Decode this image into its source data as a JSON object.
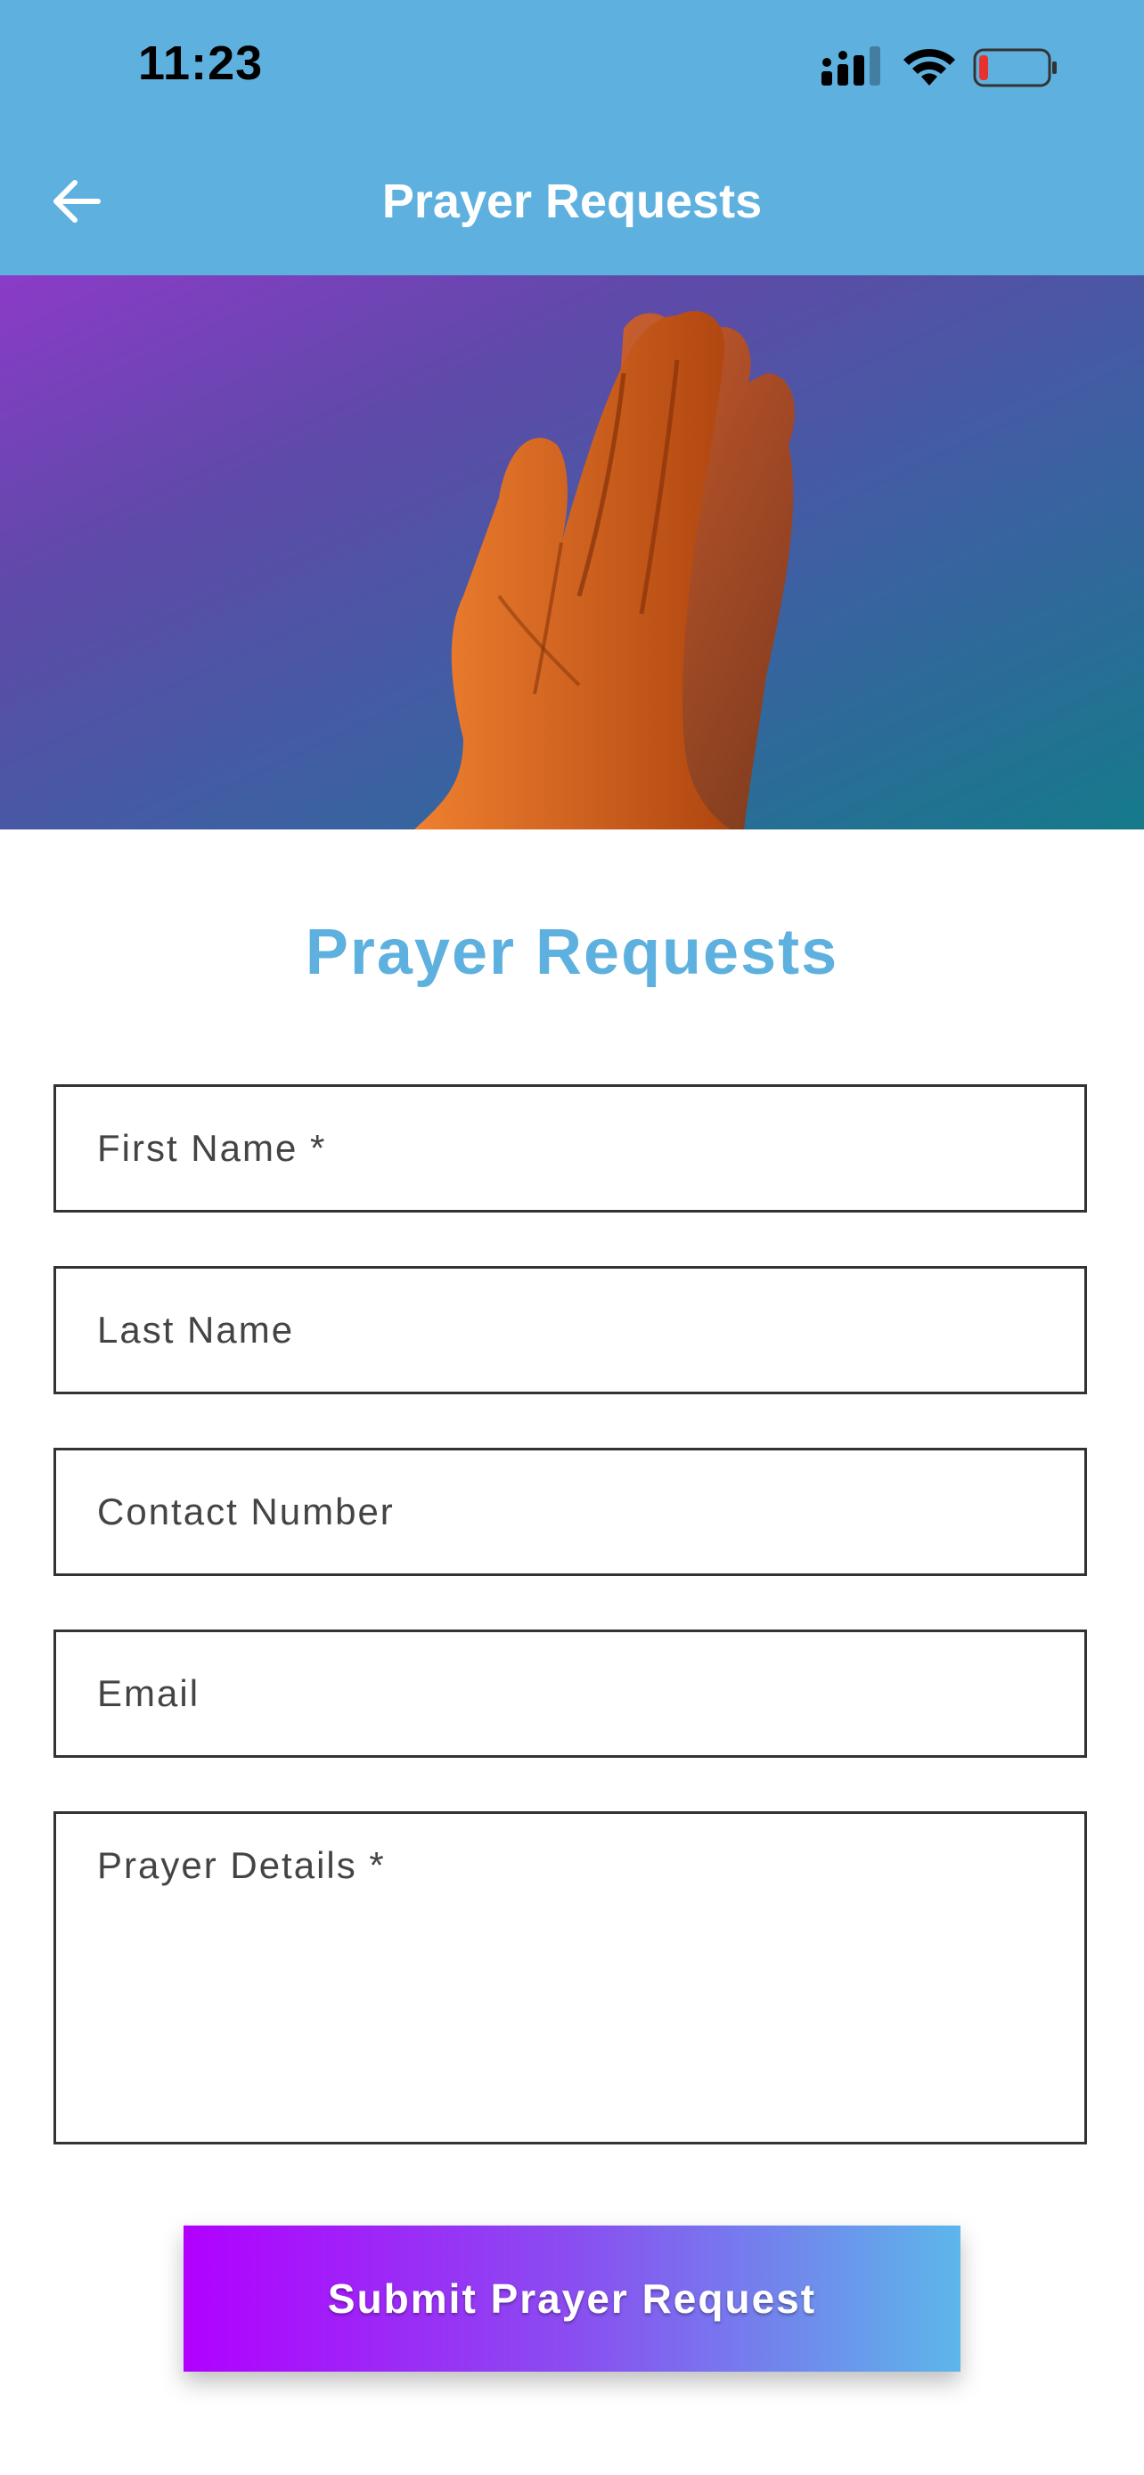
{
  "status_bar": {
    "time": "11:23",
    "icons": [
      "signal-icon",
      "wifi-icon",
      "battery-icon"
    ]
  },
  "nav": {
    "back_icon": "arrow-left-icon",
    "title": "Prayer Requests"
  },
  "hero": {
    "image": "praying-hands-image"
  },
  "form": {
    "title": "Prayer Requests",
    "fields": [
      {
        "name": "first_name",
        "value": "",
        "placeholder": "First Name *"
      },
      {
        "name": "last_name",
        "value": "",
        "placeholder": "Last Name"
      },
      {
        "name": "contact_number",
        "value": "",
        "placeholder": "Contact Number"
      },
      {
        "name": "email",
        "value": "",
        "placeholder": "Email"
      },
      {
        "name": "prayer_details",
        "value": "",
        "placeholder": "Prayer Details *"
      }
    ],
    "submit_label": "Submit Prayer Request"
  },
  "colors": {
    "header": "#5eb1df",
    "accent": "#5eb1df",
    "button_gradient_start": "#b100ff",
    "button_gradient_end": "#5db6ea"
  }
}
